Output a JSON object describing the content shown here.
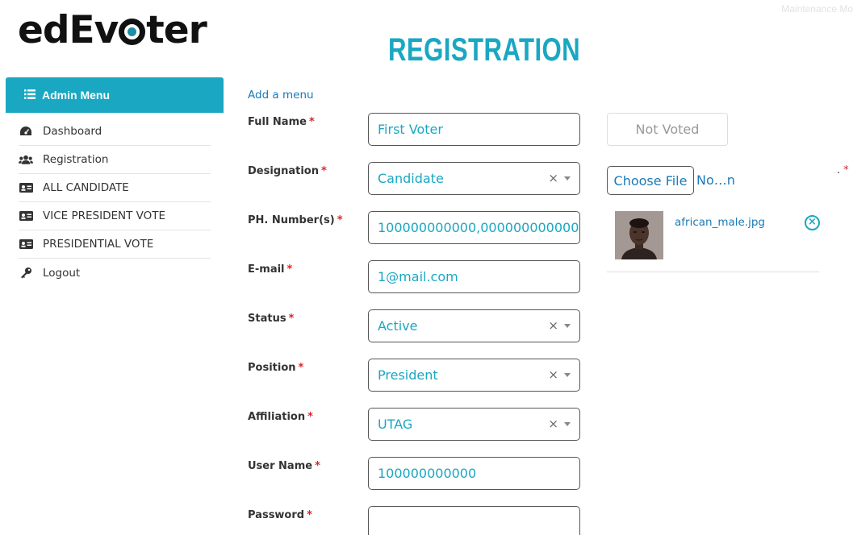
{
  "brand": {
    "logo_left": "edEv",
    "logo_right": "ter"
  },
  "maintenance_label": "Maintenance Mo",
  "page_title": "REGISTRATION",
  "sidebar": {
    "header": "Admin Menu",
    "items": [
      {
        "label": "Dashboard",
        "icon": "dashboard-icon"
      },
      {
        "label": "Registration",
        "icon": "users-icon"
      },
      {
        "label": "ALL CANDIDATE",
        "icon": "id-card-icon"
      },
      {
        "label": "VICE PRESIDENT VOTE",
        "icon": "id-card-icon"
      },
      {
        "label": "PRESIDENTIAL VOTE",
        "icon": "id-card-icon"
      },
      {
        "label": "Logout",
        "icon": "key-icon"
      }
    ]
  },
  "form": {
    "add_menu_link": "Add a menu",
    "required_mark": "*",
    "full_name": {
      "label": "Full Name",
      "value": "First Voter"
    },
    "designation": {
      "label": "Designation",
      "value": "Candidate",
      "clear": "×"
    },
    "phone": {
      "label": "PH. Number(s)",
      "value": "100000000000,000000000000"
    },
    "email": {
      "label": "E-mail",
      "value": "1@mail.com"
    },
    "status": {
      "label": "Status",
      "value": "Active",
      "clear": "×"
    },
    "position": {
      "label": "Position",
      "value": "President",
      "clear": "×"
    },
    "affiliation": {
      "label": "Affiliation",
      "value": "UTAG",
      "clear": "×"
    },
    "username": {
      "label": "User Name",
      "value": "100000000000"
    },
    "password": {
      "label": "Password",
      "value": ""
    }
  },
  "vote_status": "Not Voted",
  "upload": {
    "button_label": "Choose File",
    "no_file_text": "No…n",
    "dot": ".",
    "file_name": "african_male.jpg",
    "remove_glyph": "×"
  },
  "colors": {
    "accent": "#1aa7c2",
    "link": "#1a7ab8",
    "required": "#d9262a"
  }
}
